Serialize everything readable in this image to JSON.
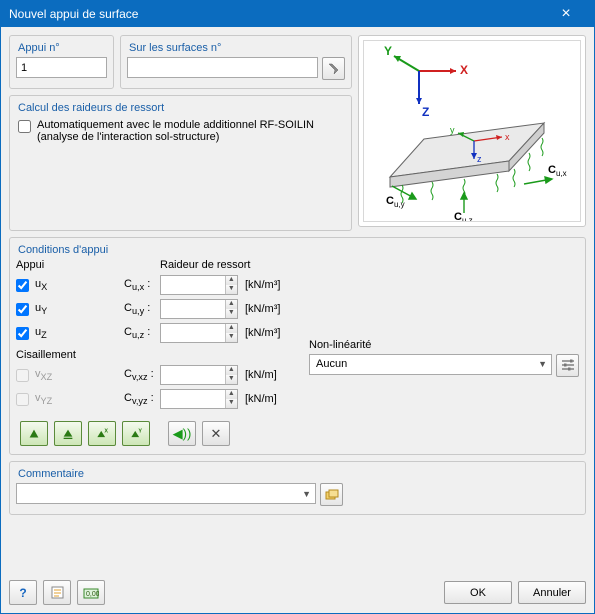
{
  "title": "Nouvel appui de surface",
  "groups": {
    "appui_no": "Appui n°",
    "sur_surfaces": "Sur les surfaces n°",
    "calc_raideurs": "Calcul des raideurs de ressort",
    "conditions": "Conditions d'appui",
    "commentaire": "Commentaire"
  },
  "fields": {
    "appui_no_value": "1",
    "surfaces_value": "",
    "soilin_checked": false,
    "soilin_label": "Automatiquement avec le module additionnel RF-SOILIN",
    "soilin_label2": "(analyse de l'interaction sol-structure)",
    "commentaire_value": ""
  },
  "cond": {
    "hdr_appui": "Appui",
    "hdr_raideur": "Raideur de ressort",
    "hdr_cisaillement": "Cisaillement",
    "rows": {
      "ux": {
        "chk": true,
        "disabled": false,
        "axis": "uX",
        "c": "Cu,x :",
        "unit": "[kN/m³]"
      },
      "uy": {
        "chk": true,
        "disabled": false,
        "axis": "uY",
        "c": "Cu,y :",
        "unit": "[kN/m³]"
      },
      "uz": {
        "chk": true,
        "disabled": false,
        "axis": "uZ",
        "c": "Cu,z :",
        "unit": "[kN/m³]"
      },
      "vxz": {
        "chk": false,
        "disabled": true,
        "axis": "vXZ",
        "c": "Cv,xz :",
        "unit": "[kN/m]"
      },
      "vyz": {
        "chk": false,
        "disabled": true,
        "axis": "vYZ",
        "c": "Cv,yz :",
        "unit": "[kN/m]"
      }
    },
    "nonlin_label": "Non-linéarité",
    "nonlin_value": "Aucun"
  },
  "buttons": {
    "ok": "OK",
    "cancel": "Annuler"
  }
}
